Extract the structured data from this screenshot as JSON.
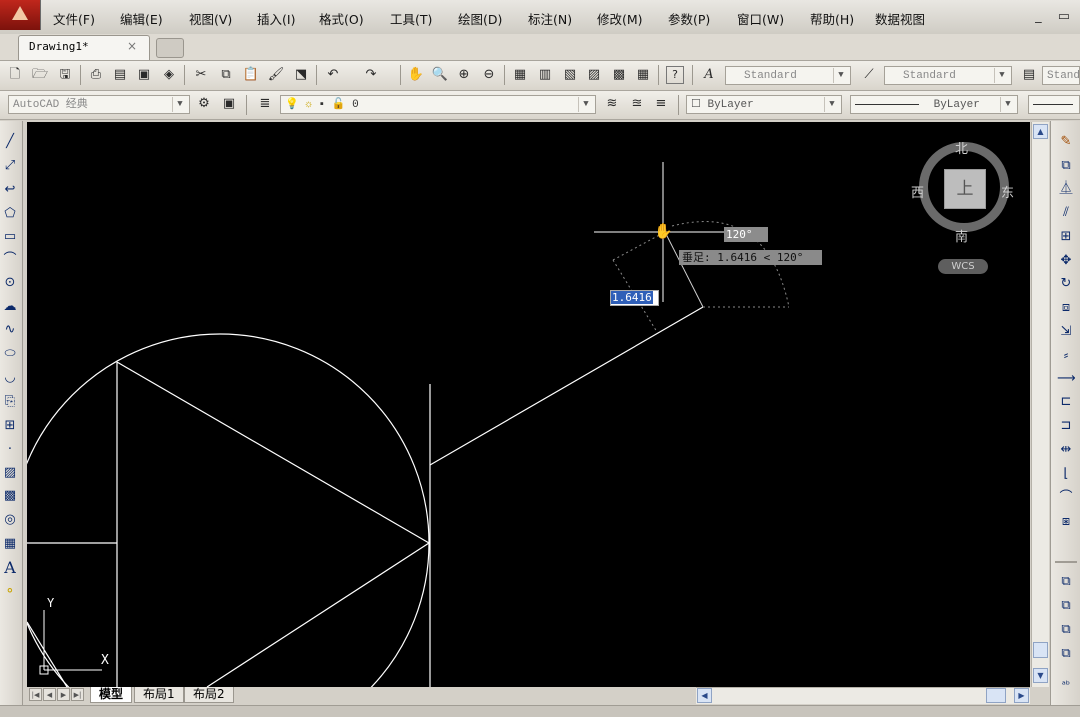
{
  "menu": [
    "文件(F)",
    "编辑(E)",
    "视图(V)",
    "插入(I)",
    "格式(O)",
    "工具(T)",
    "绘图(D)",
    "标注(N)",
    "修改(M)",
    "参数(P)",
    "窗口(W)",
    "帮助(H)",
    "数据视图"
  ],
  "window_controls": "_ ▭",
  "doc_tab": {
    "label": "Drawing1*",
    "close": "×"
  },
  "toolbar1": {
    "text_style": "Standard",
    "dim_style": "Standard",
    "table_style": "Stand"
  },
  "toolbar2": {
    "workspace": "AutoCAD 经典",
    "layer": "0",
    "color": "ByLayer",
    "linetype": "ByLayer"
  },
  "viewcube": {
    "north": "北",
    "south": "南",
    "east": "东",
    "west": "西",
    "top": "上",
    "wcs": "WCS"
  },
  "dynamic_input": {
    "angle": "120°",
    "tooltip": "垂足: 1.6416 < 120°",
    "length": "1.6416"
  },
  "ucs": {
    "x": "X",
    "y": "Y"
  },
  "layout_tabs": [
    "模型",
    "布局1",
    "布局2"
  ],
  "icons": {
    "left_toolbar": [
      "line-icon",
      "construction-line-icon",
      "polyline-icon",
      "polygon-icon",
      "rectangle-icon",
      "arc-icon",
      "circle-icon",
      "revision-cloud-icon",
      "spline-icon",
      "ellipse-icon",
      "ellipse-arc-icon",
      "insert-block-icon",
      "make-block-icon",
      "point-icon",
      "hatch-icon",
      "gradient-icon",
      "region-icon",
      "table-icon",
      "multiline-text-icon",
      "add-selected-icon"
    ],
    "right_toolbar": [
      "erase-icon",
      "copy-icon",
      "mirror-icon",
      "offset-icon",
      "array-icon",
      "move-icon",
      "rotate-icon",
      "scale-icon",
      "stretch-icon",
      "trim-icon",
      "extend-icon",
      "break-at-point-icon",
      "break-icon",
      "join-icon",
      "chamfer-icon",
      "fillet-icon",
      "explode-icon"
    ]
  },
  "colors": {
    "canvas": "#000000",
    "geometry": "#ffffff",
    "input_highlight": "#2f5fb8"
  }
}
